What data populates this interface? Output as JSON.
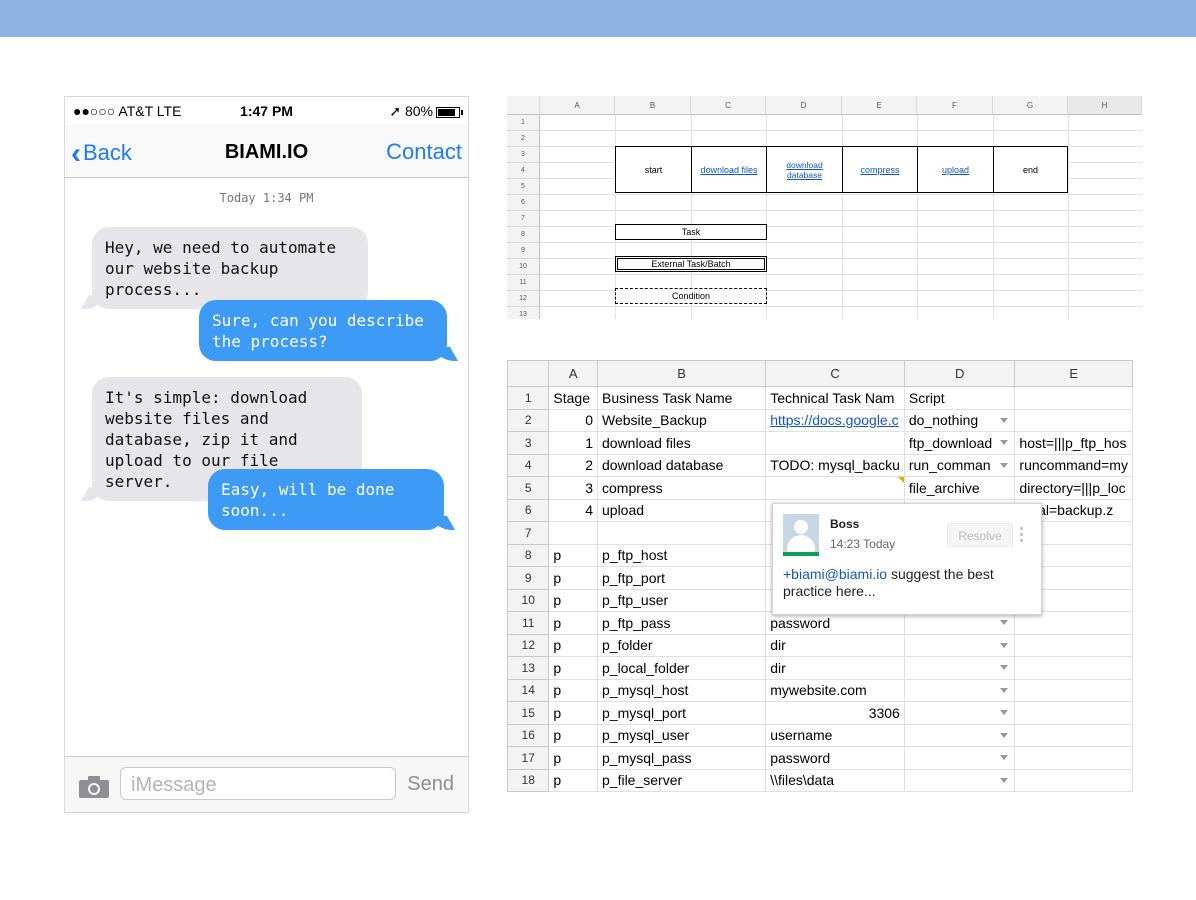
{
  "phone": {
    "carrier": "●●○○○ AT&T LTE",
    "time": "1:47 PM",
    "battery": "➚ 80%",
    "nav_back": "Back",
    "nav_title": "BIAMI.IO",
    "nav_contact": "Contact",
    "timestamp": "Today 1:34 PM",
    "messages": [
      {
        "from": "in",
        "text": "Hey, we need to automate our website backup process..."
      },
      {
        "from": "out",
        "text": "Sure, can you describe the process?"
      },
      {
        "from": "in",
        "text": "It's simple: download website files and database, zip it and upload to our file server."
      },
      {
        "from": "out",
        "text": "Easy, will be done soon..."
      }
    ],
    "input_placeholder": "iMessage",
    "send_label": "Send",
    "camera_icon": "camera-icon"
  },
  "flow_sheet": {
    "columns": [
      "A",
      "B",
      "C",
      "D",
      "E",
      "F",
      "G",
      "H"
    ],
    "rows": [
      "1",
      "2",
      "3",
      "4",
      "5",
      "6",
      "7",
      "8",
      "9",
      "10",
      "11",
      "12",
      "13"
    ],
    "steps": [
      "start",
      "download files",
      "download database",
      "compress",
      "upload",
      "end"
    ],
    "legend": {
      "task": "Task",
      "external": "External Task/Batch",
      "condition": "Condition"
    }
  },
  "task_sheet": {
    "columns": [
      "A",
      "B",
      "C",
      "D",
      "E"
    ],
    "rows": [
      {
        "n": "1",
        "a": "Stage",
        "b": "Business Task Name",
        "c": "Technical Task Nam",
        "d": "Script",
        "e": "",
        "dd": false
      },
      {
        "n": "2",
        "a": "0",
        "b": "Website_Backup",
        "c": "https://docs.google.c",
        "d": "do_nothing",
        "e": "",
        "dd": true
      },
      {
        "n": "3",
        "a": "1",
        "b": "download files",
        "c": "",
        "d": "ftp_download",
        "e": "host=|||p_ftp_hos",
        "dd": true
      },
      {
        "n": "4",
        "a": "2",
        "b": "download database",
        "c": "TODO: mysql_backu",
        "d": "run_comman",
        "e": "runcommand=my",
        "dd": true
      },
      {
        "n": "5",
        "a": "3",
        "b": "compress",
        "c": "",
        "d": "file_archive",
        "e": "directory=|||p_loc",
        "dd": false
      },
      {
        "n": "6",
        "a": "4",
        "b": "upload",
        "c": "",
        "d": "",
        "e": "dinal=backup.z",
        "dd": false
      },
      {
        "n": "7",
        "a": "",
        "b": "",
        "c": "",
        "d": "",
        "e": "",
        "dd": false
      },
      {
        "n": "8",
        "a": "p",
        "b": "p_ftp_host",
        "c": "",
        "d": "",
        "e": "",
        "dd": false
      },
      {
        "n": "9",
        "a": "p",
        "b": "p_ftp_port",
        "c": "",
        "d": "",
        "e": "",
        "dd": false
      },
      {
        "n": "10",
        "a": "p",
        "b": "p_ftp_user",
        "c": "",
        "d": "",
        "e": "",
        "dd": false
      },
      {
        "n": "11",
        "a": "p",
        "b": "p_ftp_pass",
        "c": "password",
        "d": "",
        "e": "",
        "dd": true
      },
      {
        "n": "12",
        "a": "p",
        "b": "p_folder",
        "c": "dir",
        "d": "",
        "e": "",
        "dd": true
      },
      {
        "n": "13",
        "a": "p",
        "b": "p_local_folder",
        "c": "dir",
        "d": "",
        "e": "",
        "dd": true
      },
      {
        "n": "14",
        "a": "p",
        "b": "p_mysql_host",
        "c": "mywebsite.com",
        "d": "",
        "e": "",
        "dd": true
      },
      {
        "n": "15",
        "a": "p",
        "b": "p_mysql_port",
        "c": "3306",
        "d": "",
        "e": "",
        "dd": true
      },
      {
        "n": "16",
        "a": "p",
        "b": "p_mysql_user",
        "c": "username",
        "d": "",
        "e": "",
        "dd": true
      },
      {
        "n": "17",
        "a": "p",
        "b": "p_mysql_pass",
        "c": "password",
        "d": "",
        "e": "",
        "dd": true
      },
      {
        "n": "18",
        "a": "p",
        "b": "p_file_server",
        "c": "\\\\files\\data",
        "d": "",
        "e": "",
        "dd": true
      }
    ]
  },
  "comment": {
    "author": "Boss",
    "time": "14:23 Today",
    "resolve_label": "Resolve",
    "mention": "+biami@biami.io",
    "text": " suggest the best practice here..."
  },
  "colors": {
    "top_bar": "#8fb4e3",
    "ios_blue": "#1e7cf2",
    "bubble_out": "#3d9bf6",
    "bubble_in": "#e5e5ea",
    "link": "#1155cc"
  }
}
